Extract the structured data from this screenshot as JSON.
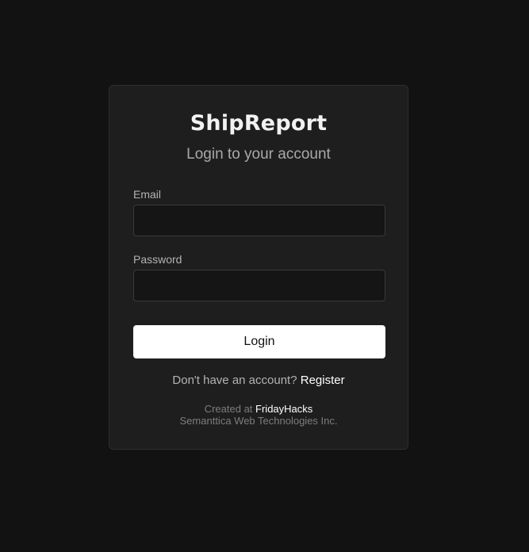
{
  "app": {
    "title": "ShipReport",
    "subtitle": "Login to your account"
  },
  "form": {
    "email": {
      "label": "Email",
      "value": "",
      "placeholder": ""
    },
    "password": {
      "label": "Password",
      "value": "",
      "placeholder": ""
    },
    "submit_label": "Login"
  },
  "register": {
    "prompt": "Don't have an account?",
    "link_label": "Register"
  },
  "footer": {
    "created_prefix": "Created at",
    "created_link": "FridayHacks",
    "company": "Semanttica Web Technologies Inc."
  },
  "colors": {
    "background": "#121212",
    "card": "#1e1e1e",
    "button": "#ffffff",
    "text": "#f2f2f2"
  }
}
